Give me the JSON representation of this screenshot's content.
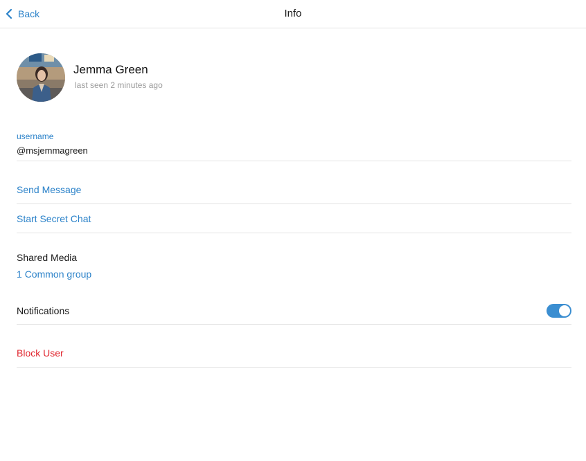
{
  "header": {
    "back_label": "Back",
    "title": "Info"
  },
  "profile": {
    "name": "Jemma Green",
    "status": "last seen 2 minutes ago"
  },
  "username": {
    "label": "username",
    "value": "@msjemmagreen"
  },
  "actions": {
    "send_message": "Send Message",
    "start_secret_chat": "Start Secret Chat"
  },
  "shared_media": {
    "title": "Shared Media",
    "common_groups_count": "1",
    "common_groups_label": "Common group"
  },
  "notifications": {
    "label": "Notifications",
    "enabled": true
  },
  "block_user": "Block User",
  "colors": {
    "accent": "#2b82c9",
    "danger": "#e0262e",
    "toggle_on": "#3b8ed1"
  }
}
